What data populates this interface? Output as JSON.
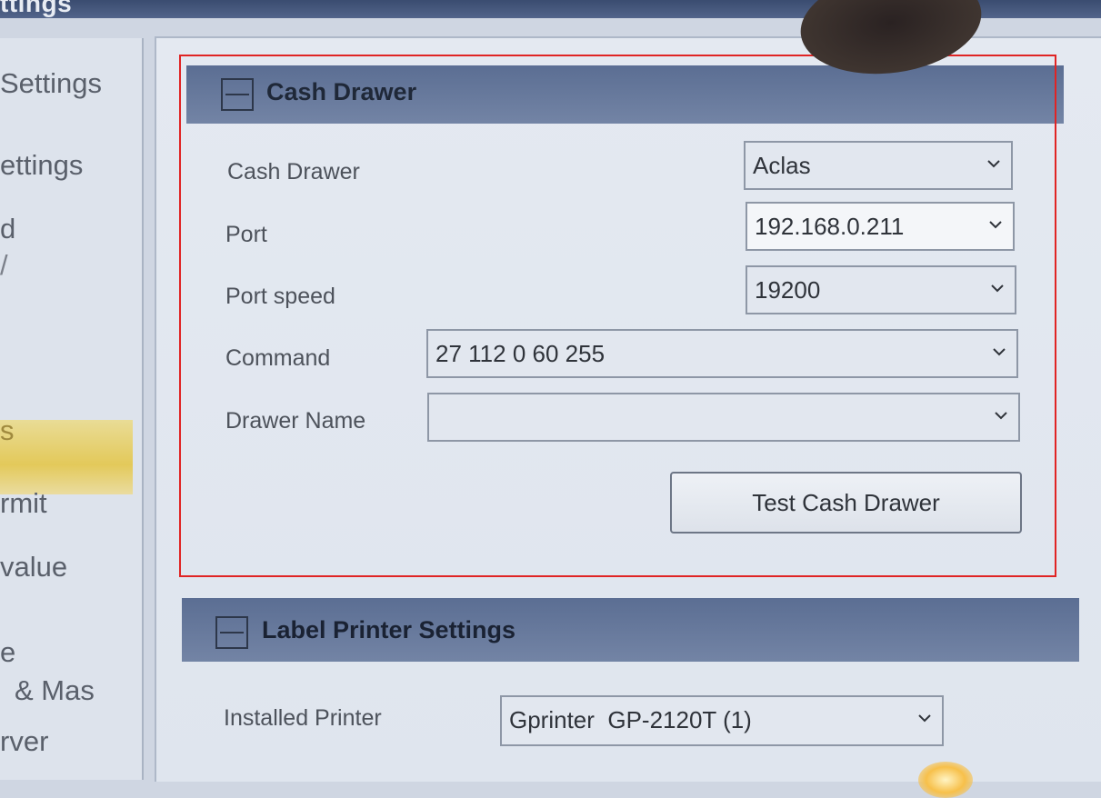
{
  "window": {
    "title_fragment": "ttings"
  },
  "sidebar": {
    "items": [
      {
        "label": "Settings"
      },
      {
        "label": "ettings"
      },
      {
        "label": "d"
      },
      {
        "label": "/"
      },
      {
        "label": "s"
      },
      {
        "label": "rmit"
      },
      {
        "label": "value"
      },
      {
        "label": "e"
      },
      {
        "label": "& Mas"
      },
      {
        "label": "rver"
      }
    ]
  },
  "cash_drawer": {
    "section_title": "Cash Drawer",
    "fields": {
      "cash_drawer": {
        "label": "Cash Drawer",
        "value": "Aclas"
      },
      "port": {
        "label": "Port",
        "value": "192.168.0.211"
      },
      "port_speed": {
        "label": "Port speed",
        "value": "19200"
      },
      "command": {
        "label": "Command",
        "value": "27 112 0 60 255"
      },
      "drawer_name": {
        "label": "Drawer Name",
        "value": ""
      }
    },
    "test_button": "Test Cash Drawer"
  },
  "label_printer": {
    "section_title": "Label Printer Settings",
    "installed_printer": {
      "label": "Installed Printer",
      "value": "Gprinter  GP-2120T (1)"
    }
  },
  "colors": {
    "highlight_frame": "#e02424",
    "section_header": "#5b6e93",
    "selected_nav": "#e3c95a"
  }
}
